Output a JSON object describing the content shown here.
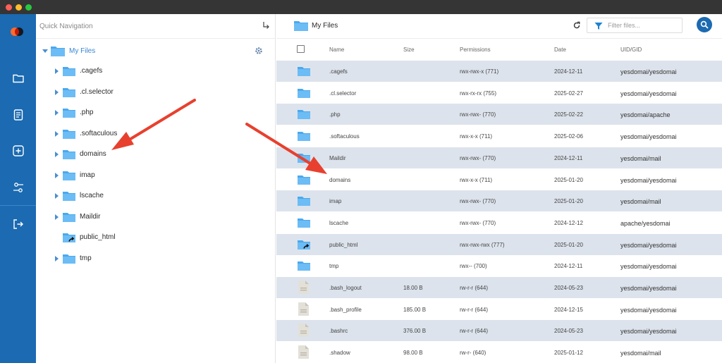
{
  "nav": {
    "title": "Quick Navigation",
    "root": "My Files",
    "items": [
      {
        "label": ".cagefs",
        "caret": true,
        "link": false
      },
      {
        "label": ".cl.selector",
        "caret": true,
        "link": false
      },
      {
        "label": ".php",
        "caret": true,
        "link": false
      },
      {
        "label": ".softaculous",
        "caret": true,
        "link": false
      },
      {
        "label": "domains",
        "caret": true,
        "link": false
      },
      {
        "label": "imap",
        "caret": true,
        "link": false
      },
      {
        "label": "lscache",
        "caret": true,
        "link": false
      },
      {
        "label": "Maildir",
        "caret": true,
        "link": false
      },
      {
        "label": "public_html",
        "caret": false,
        "link": true
      },
      {
        "label": "tmp",
        "caret": true,
        "link": false
      }
    ]
  },
  "main": {
    "breadcrumb": "My Files",
    "filter_placeholder": "Filter files...",
    "columns": {
      "name": "Name",
      "size": "Size",
      "permissions": "Permissions",
      "date": "Date",
      "uid": "UID/GID"
    },
    "rows": [
      {
        "type": "folder",
        "name": ".cagefs",
        "size": "",
        "permissions": "rwx-rwx-x (771)",
        "date": "2024-12-11",
        "uid": "yesdomai/yesdomai"
      },
      {
        "type": "folder",
        "name": ".cl.selector",
        "size": "",
        "permissions": "rwx-rx-rx (755)",
        "date": "2025-02-27",
        "uid": "yesdomai/yesdomai"
      },
      {
        "type": "folder",
        "name": ".php",
        "size": "",
        "permissions": "rwx-rwx- (770)",
        "date": "2025-02-22",
        "uid": "yesdomai/apache"
      },
      {
        "type": "folder",
        "name": ".softaculous",
        "size": "",
        "permissions": "rwx-x-x (711)",
        "date": "2025-02-06",
        "uid": "yesdomai/yesdomai"
      },
      {
        "type": "folder",
        "name": "Maildir",
        "size": "",
        "permissions": "rwx-rwx- (770)",
        "date": "2024-12-11",
        "uid": "yesdomai/mail"
      },
      {
        "type": "folder",
        "name": "domains",
        "size": "",
        "permissions": "rwx-x-x (711)",
        "date": "2025-01-20",
        "uid": "yesdomai/yesdomai"
      },
      {
        "type": "folder",
        "name": "imap",
        "size": "",
        "permissions": "rwx-rwx- (770)",
        "date": "2025-01-20",
        "uid": "yesdomai/mail"
      },
      {
        "type": "folder",
        "name": "lscache",
        "size": "",
        "permissions": "rwx-rwx- (770)",
        "date": "2024-12-12",
        "uid": "apache/yesdomai"
      },
      {
        "type": "link",
        "name": "public_html",
        "size": "",
        "permissions": "rwx-rwx-rwx (777)",
        "date": "2025-01-20",
        "uid": "yesdomai/yesdomai"
      },
      {
        "type": "folder",
        "name": "tmp",
        "size": "",
        "permissions": "rwx-- (700)",
        "date": "2024-12-11",
        "uid": "yesdomai/yesdomai"
      },
      {
        "type": "file",
        "name": ".bash_logout",
        "size": "18.00 B",
        "permissions": "rw-r-r (644)",
        "date": "2024-05-23",
        "uid": "yesdomai/yesdomai"
      },
      {
        "type": "file",
        "name": ".bash_profile",
        "size": "185.00 B",
        "permissions": "rw-r-r (644)",
        "date": "2024-12-15",
        "uid": "yesdomai/yesdomai"
      },
      {
        "type": "file",
        "name": ".bashrc",
        "size": "376.00 B",
        "permissions": "rw-r-r (644)",
        "date": "2024-05-23",
        "uid": "yesdomai/yesdomai"
      },
      {
        "type": "file",
        "name": ".shadow",
        "size": "98.00 B",
        "permissions": "rw-r- (640)",
        "date": "2025-01-12",
        "uid": "yesdomai/mail"
      }
    ]
  },
  "colors": {
    "rail": "#1b6ab2",
    "folder": "#4aa8ee",
    "row_alt": "#dce3ec",
    "arrow": "#e8402f",
    "logo": "#ff6a2b"
  },
  "icons": {
    "rail": [
      "folder-icon",
      "document-icon",
      "add-icon",
      "settings-sliders-icon",
      "logout-icon"
    ],
    "search": "search-icon",
    "filter": "filter-icon",
    "refresh": "refresh-icon",
    "settings": "gear-icon",
    "collapse": "collapse-arrow-icon"
  }
}
